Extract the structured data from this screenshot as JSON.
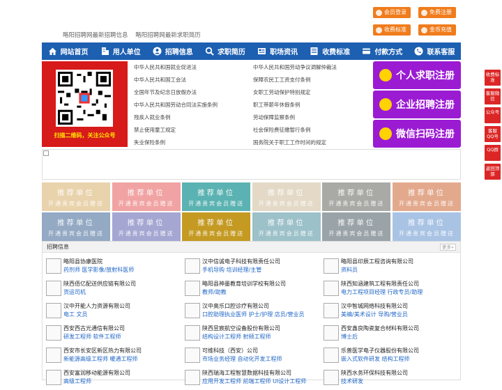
{
  "header": {
    "links": [
      "略阳招聘网最新招聘信息",
      "略阳招聘网最新求职简历"
    ],
    "buttons": [
      "会员登录",
      "免费注册",
      "收费标准",
      "金币充值"
    ]
  },
  "nav": {
    "items": [
      "网站首页",
      "用人单位",
      "招聘信息",
      "求职简历",
      "职场资讯",
      "收费标准",
      "付款方式",
      "联系客服"
    ]
  },
  "qr": {
    "caption": "扫描二维码，关注公众号"
  },
  "laws": {
    "left": [
      "中华人民共和国就业促进法",
      "中华人民共和国工会法",
      "全国年节及纪念日放假办法",
      "中华人民共和国劳动合同法实施条例",
      "残疾人就业条例",
      "禁止使用童工规定",
      "失业保险条例"
    ],
    "right": [
      "中华人民共和国劳动争议调解仲裁法",
      "保障农民工工资支付条例",
      "女职工劳动保护特别规定",
      "职工带薪年休假条例",
      "劳动保障监察条例",
      "社会保险费征缴暂行条例",
      "国务院关于职工工作时间的规定"
    ]
  },
  "register": [
    "个人求职注册",
    "企业招聘注册",
    "微信扫码注册"
  ],
  "recommend": {
    "title": "推荐单位",
    "subtitle": "开通贵宾会员赠送",
    "colors": [
      "#e9d3ac",
      "#f1a3a3",
      "#5bb2b2",
      "#e3d9c6",
      "#a9aaa6",
      "#e3a98d",
      "#93a9c4",
      "#a5a6d2",
      "#c49a23",
      "#9cc1c9",
      "#9aa3a8",
      "#a9c3e4"
    ]
  },
  "jobs": {
    "title": "招聘信息",
    "more": "更多»",
    "items": [
      {
        "company": "略阳县协康医院",
        "positions": "药剂师 医学影像/放射科医师"
      },
      {
        "company": "汉中信诚电子科技有限责任公司",
        "positions": "手机导购 培训经理/主管"
      },
      {
        "company": "略阳县印辰工程咨询有限公司",
        "positions": "资料员"
      },
      {
        "company": "陕西佰亿配送供应链有限公司",
        "positions": "货运司机"
      },
      {
        "company": "略阳县神墨教育培训学校有限公司",
        "positions": "教师/助教"
      },
      {
        "company": "陕西知涵建筑工程有限责任公司",
        "positions": "电力工程项目经理 行政专员/助理"
      },
      {
        "company": "汉中开能人力资源有限公司",
        "positions": "电工 文员"
      },
      {
        "company": "汉中奥乐口腔诊疗有限公司",
        "positions": "口腔助理执业医师 护士/护理 店员/营业员"
      },
      {
        "company": "汉中智城网络科技有限公司",
        "positions": "美编/美术设计 导购/营业员"
      },
      {
        "company": "西安西古光通信有限公司",
        "positions": "研发工程师 软件工程师"
      },
      {
        "company": "陕西昱宸航空设备股份有限公司",
        "positions": "结构设计工程师 射频工程师"
      },
      {
        "company": "西安鑫良陶瓷复合材料有限公司",
        "positions": "博士后"
      },
      {
        "company": "西安市长安区新区热力有限公司",
        "positions": "新能源高级工程师 暖通工程师"
      },
      {
        "company": "可维科技（西安）公司",
        "positions": "市场业务经理 自动化开发工程师"
      },
      {
        "company": "乐普医学电子仪器股份有限公司",
        "positions": "嵌入式软件研发 结构工程师"
      },
      {
        "company": "西安富润移动能源有限公司",
        "positions": "高级工程师"
      },
      {
        "company": "陕西瑞海工程智慧数据科技有限公司",
        "positions": "应用开发工程师 前端工程师 UI设计工程师"
      },
      {
        "company": "陕西水务环保科技有限公司",
        "positions": "技术研发"
      }
    ]
  },
  "float": [
    "收费标准",
    "客服微信",
    "公众号",
    "客服QQ号",
    "QQ群",
    "返回顶部"
  ]
}
